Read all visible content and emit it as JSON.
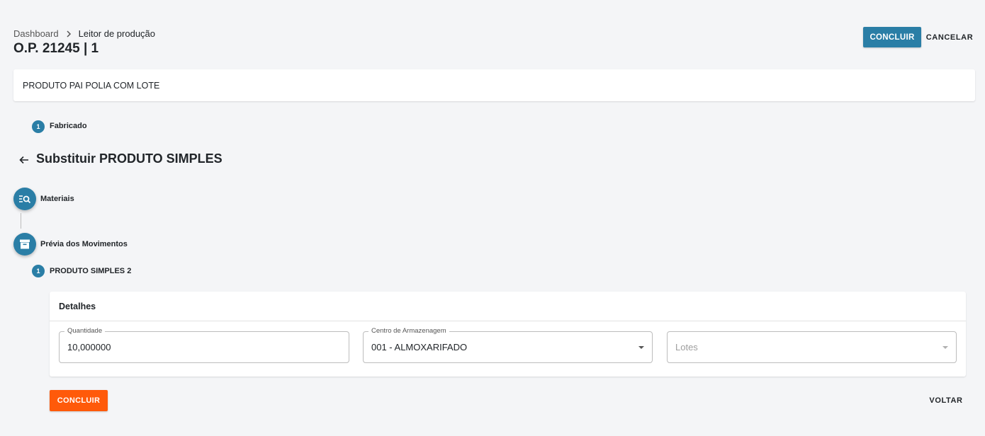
{
  "breadcrumb": {
    "root": "Dashboard",
    "current": "Leitor de produção"
  },
  "page": {
    "title": "O.P. 21245 | 1"
  },
  "actions": {
    "confirm_label": "CONCLUIR",
    "cancel_label": "CANCELAR"
  },
  "product": {
    "name": "PRODUTO PAI POLIA COM LOTE"
  },
  "steps": {
    "fabricado": {
      "number": "1",
      "label": "Fabricado"
    },
    "materiais": {
      "label": "Materiais",
      "icon": "search-list-icon"
    },
    "previa": {
      "label": "Prévia dos Movimentos",
      "icon": "archive-box-icon"
    },
    "produto_simples": {
      "number": "1",
      "label": "PRODUTO SIMPLES 2"
    }
  },
  "section": {
    "title": "Substituir PRODUTO SIMPLES"
  },
  "details": {
    "title": "Detalhes",
    "quantidade": {
      "label": "Quantidade",
      "value": "10,000000"
    },
    "centro": {
      "label": "Centro de Armazenagem",
      "value": "001 - ALMOXARIFADO"
    },
    "lotes": {
      "placeholder": "Lotes"
    }
  },
  "footer": {
    "confirm_label": "CONCLUIR",
    "back_label": "VOLTAR"
  },
  "colors": {
    "primary": "#2a7ea6",
    "accent": "#ff5a0a",
    "background": "#f4f5f7"
  }
}
